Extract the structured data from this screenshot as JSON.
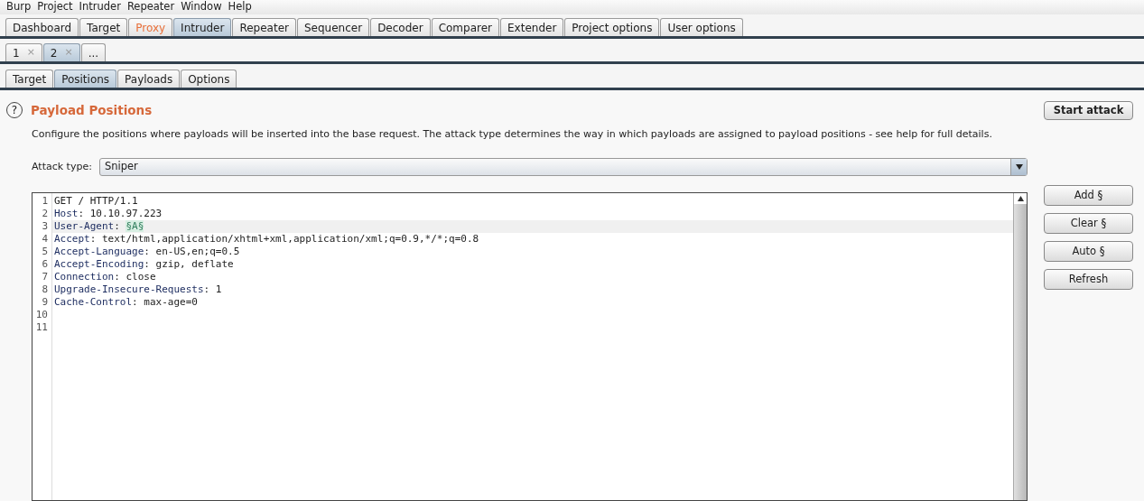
{
  "menu_bar": [
    "Burp",
    "Project",
    "Intruder",
    "Repeater",
    "Window",
    "Help"
  ],
  "main_tabs": [
    {
      "label": "Dashboard",
      "selected": false,
      "highlighted": false
    },
    {
      "label": "Target",
      "selected": false,
      "highlighted": false
    },
    {
      "label": "Proxy",
      "selected": false,
      "highlighted": true
    },
    {
      "label": "Intruder",
      "selected": true,
      "highlighted": false
    },
    {
      "label": "Repeater",
      "selected": false,
      "highlighted": false
    },
    {
      "label": "Sequencer",
      "selected": false,
      "highlighted": false
    },
    {
      "label": "Decoder",
      "selected": false,
      "highlighted": false
    },
    {
      "label": "Comparer",
      "selected": false,
      "highlighted": false
    },
    {
      "label": "Extender",
      "selected": false,
      "highlighted": false
    },
    {
      "label": "Project options",
      "selected": false,
      "highlighted": false
    },
    {
      "label": "User options",
      "selected": false,
      "highlighted": false
    }
  ],
  "attack_tabs": [
    {
      "label": "1",
      "close": "×",
      "selected": false
    },
    {
      "label": "2",
      "close": "×",
      "selected": true
    },
    {
      "label": "...",
      "selected": false
    }
  ],
  "sub_tabs": [
    {
      "label": "Target",
      "selected": false
    },
    {
      "label": "Positions",
      "selected": true
    },
    {
      "label": "Payloads",
      "selected": false
    },
    {
      "label": "Options",
      "selected": false
    }
  ],
  "section": {
    "help": "?",
    "title": "Payload Positions",
    "description": "Configure the positions where payloads will be inserted into the base request. The attack type determines the way in which payloads are assigned to payload positions - see help for full details.",
    "start_button": "Start attack"
  },
  "attack_type": {
    "label": "Attack type:",
    "value": "Sniper"
  },
  "request_lines": [
    {
      "number": "1",
      "kind": "plain",
      "text": "GET / HTTP/1.1",
      "highlighted": false
    },
    {
      "number": "2",
      "kind": "header",
      "name": "Host",
      "separator": ": ",
      "value": "10.10.97.223",
      "highlighted": false
    },
    {
      "number": "3",
      "kind": "header",
      "name": "User-Agent",
      "separator": ": ",
      "payload": "§A§",
      "highlighted": true
    },
    {
      "number": "4",
      "kind": "header",
      "name": "Accept",
      "separator": ": ",
      "value": "text/html,application/xhtml+xml,application/xml;q=0.9,*/*;q=0.8",
      "highlighted": false
    },
    {
      "number": "5",
      "kind": "header",
      "name": "Accept-Language",
      "separator": ": ",
      "value": "en-US,en;q=0.5",
      "highlighted": false
    },
    {
      "number": "6",
      "kind": "header",
      "name": "Accept-Encoding",
      "separator": ": ",
      "value": "gzip, deflate",
      "highlighted": false
    },
    {
      "number": "7",
      "kind": "header",
      "name": "Connection",
      "separator": ": ",
      "value": "close",
      "highlighted": false
    },
    {
      "number": "8",
      "kind": "header",
      "name": "Upgrade-Insecure-Requests",
      "separator": ": ",
      "value": "1",
      "highlighted": false
    },
    {
      "number": "9",
      "kind": "header",
      "name": "Cache-Control",
      "separator": ": ",
      "value": "max-age=0",
      "highlighted": false
    },
    {
      "number": "10",
      "kind": "empty",
      "highlighted": false
    },
    {
      "number": "11",
      "kind": "empty",
      "highlighted": false
    }
  ],
  "side_buttons": [
    "Add §",
    "Clear §",
    "Auto §",
    "Refresh"
  ]
}
